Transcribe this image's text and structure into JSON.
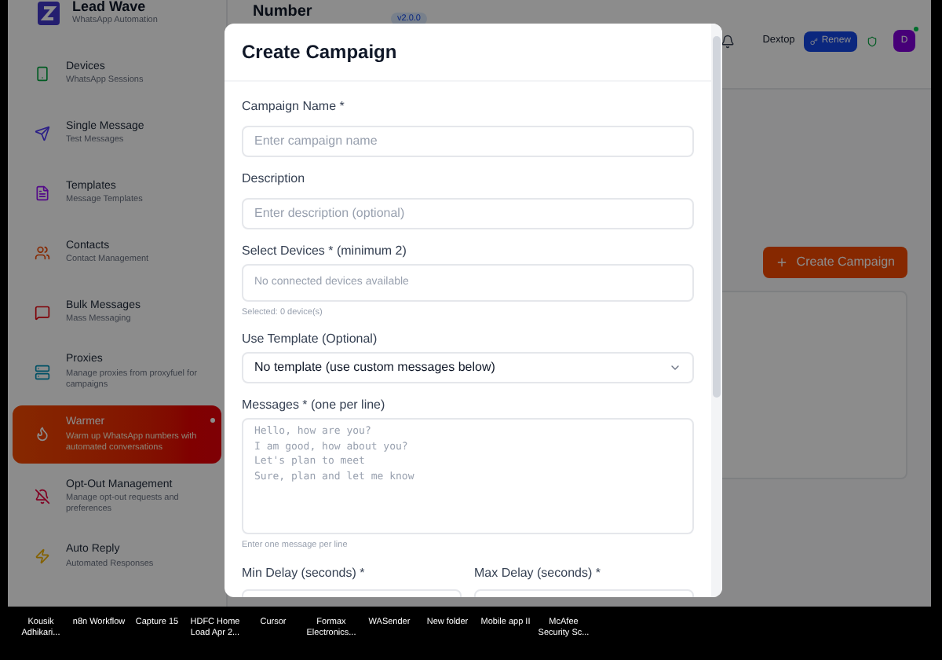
{
  "app": {
    "logo": {
      "title": "Lead Wave",
      "subtitle": "WhatsApp Automation"
    },
    "sidebar": {
      "items": [
        {
          "title": "Devices",
          "subtitle": "WhatsApp Sessions",
          "selected": false
        },
        {
          "title": "Single Message",
          "subtitle": "Test Messages",
          "selected": false
        },
        {
          "title": "Templates",
          "subtitle": "Message Templates",
          "selected": false
        },
        {
          "title": "Contacts",
          "subtitle": "Contact Management",
          "selected": false
        },
        {
          "title": "Bulk Messages",
          "subtitle": "Mass Messaging",
          "selected": false
        },
        {
          "title": "Proxies",
          "subtitle": "Manage proxies from proxyfuel for campaigns",
          "selected": false
        },
        {
          "title": "Warmer",
          "subtitle": "Warm up WhatsApp numbers with automated conversations",
          "selected": true
        },
        {
          "title": "Opt-Out Management",
          "subtitle": "Manage opt-out requests and preferences",
          "selected": false
        },
        {
          "title": "Auto Reply",
          "subtitle": "Automated Responses",
          "selected": false
        }
      ]
    },
    "header": {
      "title": "Number",
      "version": "v2.0.0",
      "user": "Dextop",
      "renew_button": "Renew",
      "avatar": "D"
    },
    "main": {
      "create_button": "Create Campaign"
    }
  },
  "modal": {
    "title": "Create Campaign",
    "fields": [
      {
        "kind": "text",
        "label": "Campaign Name *",
        "placeholder": "Enter campaign name"
      },
      {
        "kind": "text",
        "label": "Description",
        "placeholder": "Enter description (optional)"
      },
      {
        "kind": "devices",
        "label": "Select Devices * (minimum 2)",
        "empty_text": "No connected devices available",
        "hint": "Selected: 0 device(s)"
      },
      {
        "kind": "select",
        "label": "Use Template (Optional)",
        "value": "No template (use custom messages below)"
      },
      {
        "kind": "textarea",
        "label": "Messages * (one per line)",
        "placeholder": "Hello, how are you?\nI am good, how about you?\nLet's plan to meet\nSure, plan and let me know",
        "hint": "Enter one message per line"
      },
      {
        "kind": "pair",
        "labels": [
          "Min Delay (seconds) *",
          "Max Delay (seconds) *"
        ]
      }
    ]
  },
  "taskbar": {
    "items": [
      "Kousik Adhikari...",
      "n8n Workflow",
      "Capture 15",
      "HDFC Home Load Apr 2...",
      "Cursor",
      "Formax Electronics...",
      "WASender",
      "New folder",
      "Mobile app II",
      "McAfee Security Sc..."
    ]
  }
}
